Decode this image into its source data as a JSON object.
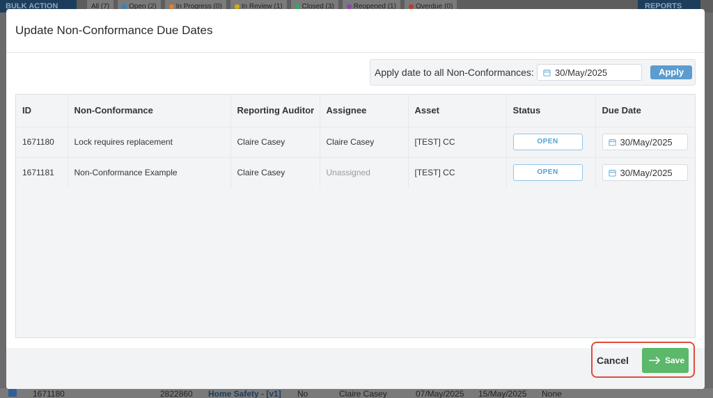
{
  "background": {
    "bulk_action": "BULK ACTION",
    "reports": "REPORTS",
    "filters": [
      {
        "label": "All (7)",
        "color": ""
      },
      {
        "label": "Open (2)",
        "color": "#2e86c1"
      },
      {
        "label": "In Progress (0)",
        "color": "#e67e22"
      },
      {
        "label": "In Review (1)",
        "color": "#d4ac0d"
      },
      {
        "label": "Closed (3)",
        "color": "#27ae60"
      },
      {
        "label": "Reopened (1)",
        "color": "#8e44ad"
      },
      {
        "label": "Overdue (0)",
        "color": "#c0392b"
      }
    ],
    "bottom_row": {
      "id": "1671180",
      "score": "2822860",
      "template": "Home Safety - [v1]",
      "flag": "No",
      "auditor": "Claire Casey",
      "created": "07/May/2025",
      "due": "15/May/2025",
      "assignee": "None"
    }
  },
  "modal": {
    "title": "Update Non-Conformance Due Dates",
    "apply_label": "Apply date to all Non-Conformances:",
    "apply_date": "30/May/2025",
    "apply_button": "Apply",
    "columns": [
      "ID",
      "Non-Conformance",
      "Reporting Auditor",
      "Assignee",
      "Asset",
      "Status",
      "Due Date"
    ],
    "rows": [
      {
        "id": "1671180",
        "nc": "Lock requires replacement",
        "auditor": "Claire Casey",
        "assignee": "Claire Casey",
        "asset": "[TEST] CC",
        "status": "OPEN",
        "due": "30/May/2025"
      },
      {
        "id": "1671181",
        "nc": "Non-Conformance Example",
        "auditor": "Claire Casey",
        "assignee": "Unassigned",
        "asset": "[TEST] CC",
        "status": "OPEN",
        "due": "30/May/2025"
      }
    ],
    "cancel_label": "Cancel",
    "save_label": "Save"
  },
  "colors": {
    "accent": "#5c9ccf",
    "save": "#5cb86a",
    "highlight": "#e04b3b",
    "status_open": "#4fa3d6"
  }
}
